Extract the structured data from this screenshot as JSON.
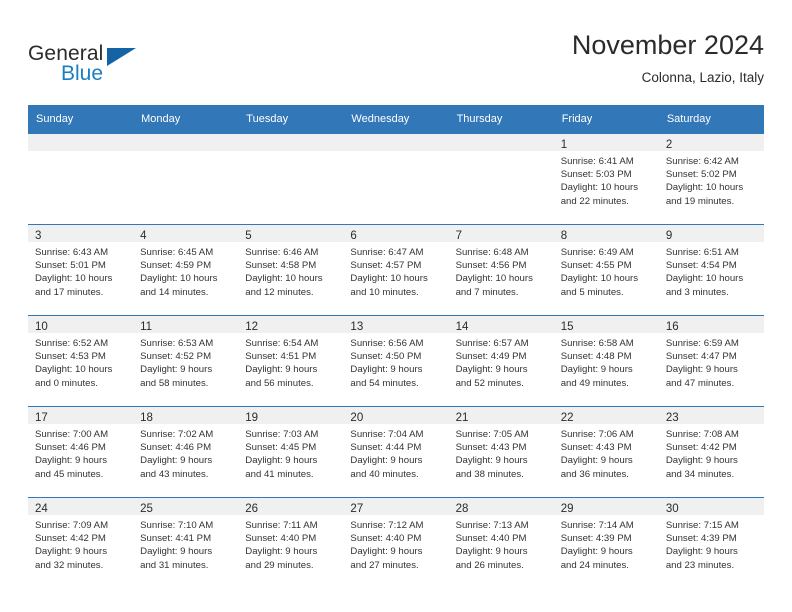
{
  "brand": {
    "word_one": "General",
    "word_two": "Blue",
    "logo_icon": "triangle-logo-icon",
    "accent_color": "#1464a5",
    "blue_text_color": "#1a7fc1"
  },
  "header": {
    "title": "November 2024",
    "location": "Colonna, Lazio, Italy"
  },
  "theme": {
    "header_row_bg": "#3277b8",
    "daynum_band_bg": "#f0f0f0",
    "cell_border": "#3277b8",
    "text_color": "#2b2b2b"
  },
  "weekday_headers": [
    "Sunday",
    "Monday",
    "Tuesday",
    "Wednesday",
    "Thursday",
    "Friday",
    "Saturday"
  ],
  "weeks": [
    [
      {
        "day": "",
        "sunrise": "",
        "sunset": "",
        "daylight_line1": "",
        "daylight_line2": "",
        "empty": true
      },
      {
        "day": "",
        "sunrise": "",
        "sunset": "",
        "daylight_line1": "",
        "daylight_line2": "",
        "empty": true
      },
      {
        "day": "",
        "sunrise": "",
        "sunset": "",
        "daylight_line1": "",
        "daylight_line2": "",
        "empty": true
      },
      {
        "day": "",
        "sunrise": "",
        "sunset": "",
        "daylight_line1": "",
        "daylight_line2": "",
        "empty": true
      },
      {
        "day": "",
        "sunrise": "",
        "sunset": "",
        "daylight_line1": "",
        "daylight_line2": "",
        "empty": true
      },
      {
        "day": "1",
        "sunrise": "Sunrise: 6:41 AM",
        "sunset": "Sunset: 5:03 PM",
        "daylight_line1": "Daylight: 10 hours",
        "daylight_line2": "and 22 minutes.",
        "empty": false
      },
      {
        "day": "2",
        "sunrise": "Sunrise: 6:42 AM",
        "sunset": "Sunset: 5:02 PM",
        "daylight_line1": "Daylight: 10 hours",
        "daylight_line2": "and 19 minutes.",
        "empty": false
      }
    ],
    [
      {
        "day": "3",
        "sunrise": "Sunrise: 6:43 AM",
        "sunset": "Sunset: 5:01 PM",
        "daylight_line1": "Daylight: 10 hours",
        "daylight_line2": "and 17 minutes.",
        "empty": false
      },
      {
        "day": "4",
        "sunrise": "Sunrise: 6:45 AM",
        "sunset": "Sunset: 4:59 PM",
        "daylight_line1": "Daylight: 10 hours",
        "daylight_line2": "and 14 minutes.",
        "empty": false
      },
      {
        "day": "5",
        "sunrise": "Sunrise: 6:46 AM",
        "sunset": "Sunset: 4:58 PM",
        "daylight_line1": "Daylight: 10 hours",
        "daylight_line2": "and 12 minutes.",
        "empty": false
      },
      {
        "day": "6",
        "sunrise": "Sunrise: 6:47 AM",
        "sunset": "Sunset: 4:57 PM",
        "daylight_line1": "Daylight: 10 hours",
        "daylight_line2": "and 10 minutes.",
        "empty": false
      },
      {
        "day": "7",
        "sunrise": "Sunrise: 6:48 AM",
        "sunset": "Sunset: 4:56 PM",
        "daylight_line1": "Daylight: 10 hours",
        "daylight_line2": "and 7 minutes.",
        "empty": false
      },
      {
        "day": "8",
        "sunrise": "Sunrise: 6:49 AM",
        "sunset": "Sunset: 4:55 PM",
        "daylight_line1": "Daylight: 10 hours",
        "daylight_line2": "and 5 minutes.",
        "empty": false
      },
      {
        "day": "9",
        "sunrise": "Sunrise: 6:51 AM",
        "sunset": "Sunset: 4:54 PM",
        "daylight_line1": "Daylight: 10 hours",
        "daylight_line2": "and 3 minutes.",
        "empty": false
      }
    ],
    [
      {
        "day": "10",
        "sunrise": "Sunrise: 6:52 AM",
        "sunset": "Sunset: 4:53 PM",
        "daylight_line1": "Daylight: 10 hours",
        "daylight_line2": "and 0 minutes.",
        "empty": false
      },
      {
        "day": "11",
        "sunrise": "Sunrise: 6:53 AM",
        "sunset": "Sunset: 4:52 PM",
        "daylight_line1": "Daylight: 9 hours",
        "daylight_line2": "and 58 minutes.",
        "empty": false
      },
      {
        "day": "12",
        "sunrise": "Sunrise: 6:54 AM",
        "sunset": "Sunset: 4:51 PM",
        "daylight_line1": "Daylight: 9 hours",
        "daylight_line2": "and 56 minutes.",
        "empty": false
      },
      {
        "day": "13",
        "sunrise": "Sunrise: 6:56 AM",
        "sunset": "Sunset: 4:50 PM",
        "daylight_line1": "Daylight: 9 hours",
        "daylight_line2": "and 54 minutes.",
        "empty": false
      },
      {
        "day": "14",
        "sunrise": "Sunrise: 6:57 AM",
        "sunset": "Sunset: 4:49 PM",
        "daylight_line1": "Daylight: 9 hours",
        "daylight_line2": "and 52 minutes.",
        "empty": false
      },
      {
        "day": "15",
        "sunrise": "Sunrise: 6:58 AM",
        "sunset": "Sunset: 4:48 PM",
        "daylight_line1": "Daylight: 9 hours",
        "daylight_line2": "and 49 minutes.",
        "empty": false
      },
      {
        "day": "16",
        "sunrise": "Sunrise: 6:59 AM",
        "sunset": "Sunset: 4:47 PM",
        "daylight_line1": "Daylight: 9 hours",
        "daylight_line2": "and 47 minutes.",
        "empty": false
      }
    ],
    [
      {
        "day": "17",
        "sunrise": "Sunrise: 7:00 AM",
        "sunset": "Sunset: 4:46 PM",
        "daylight_line1": "Daylight: 9 hours",
        "daylight_line2": "and 45 minutes.",
        "empty": false
      },
      {
        "day": "18",
        "sunrise": "Sunrise: 7:02 AM",
        "sunset": "Sunset: 4:46 PM",
        "daylight_line1": "Daylight: 9 hours",
        "daylight_line2": "and 43 minutes.",
        "empty": false
      },
      {
        "day": "19",
        "sunrise": "Sunrise: 7:03 AM",
        "sunset": "Sunset: 4:45 PM",
        "daylight_line1": "Daylight: 9 hours",
        "daylight_line2": "and 41 minutes.",
        "empty": false
      },
      {
        "day": "20",
        "sunrise": "Sunrise: 7:04 AM",
        "sunset": "Sunset: 4:44 PM",
        "daylight_line1": "Daylight: 9 hours",
        "daylight_line2": "and 40 minutes.",
        "empty": false
      },
      {
        "day": "21",
        "sunrise": "Sunrise: 7:05 AM",
        "sunset": "Sunset: 4:43 PM",
        "daylight_line1": "Daylight: 9 hours",
        "daylight_line2": "and 38 minutes.",
        "empty": false
      },
      {
        "day": "22",
        "sunrise": "Sunrise: 7:06 AM",
        "sunset": "Sunset: 4:43 PM",
        "daylight_line1": "Daylight: 9 hours",
        "daylight_line2": "and 36 minutes.",
        "empty": false
      },
      {
        "day": "23",
        "sunrise": "Sunrise: 7:08 AM",
        "sunset": "Sunset: 4:42 PM",
        "daylight_line1": "Daylight: 9 hours",
        "daylight_line2": "and 34 minutes.",
        "empty": false
      }
    ],
    [
      {
        "day": "24",
        "sunrise": "Sunrise: 7:09 AM",
        "sunset": "Sunset: 4:42 PM",
        "daylight_line1": "Daylight: 9 hours",
        "daylight_line2": "and 32 minutes.",
        "empty": false
      },
      {
        "day": "25",
        "sunrise": "Sunrise: 7:10 AM",
        "sunset": "Sunset: 4:41 PM",
        "daylight_line1": "Daylight: 9 hours",
        "daylight_line2": "and 31 minutes.",
        "empty": false
      },
      {
        "day": "26",
        "sunrise": "Sunrise: 7:11 AM",
        "sunset": "Sunset: 4:40 PM",
        "daylight_line1": "Daylight: 9 hours",
        "daylight_line2": "and 29 minutes.",
        "empty": false
      },
      {
        "day": "27",
        "sunrise": "Sunrise: 7:12 AM",
        "sunset": "Sunset: 4:40 PM",
        "daylight_line1": "Daylight: 9 hours",
        "daylight_line2": "and 27 minutes.",
        "empty": false
      },
      {
        "day": "28",
        "sunrise": "Sunrise: 7:13 AM",
        "sunset": "Sunset: 4:40 PM",
        "daylight_line1": "Daylight: 9 hours",
        "daylight_line2": "and 26 minutes.",
        "empty": false
      },
      {
        "day": "29",
        "sunrise": "Sunrise: 7:14 AM",
        "sunset": "Sunset: 4:39 PM",
        "daylight_line1": "Daylight: 9 hours",
        "daylight_line2": "and 24 minutes.",
        "empty": false
      },
      {
        "day": "30",
        "sunrise": "Sunrise: 7:15 AM",
        "sunset": "Sunset: 4:39 PM",
        "daylight_line1": "Daylight: 9 hours",
        "daylight_line2": "and 23 minutes.",
        "empty": false
      }
    ]
  ]
}
